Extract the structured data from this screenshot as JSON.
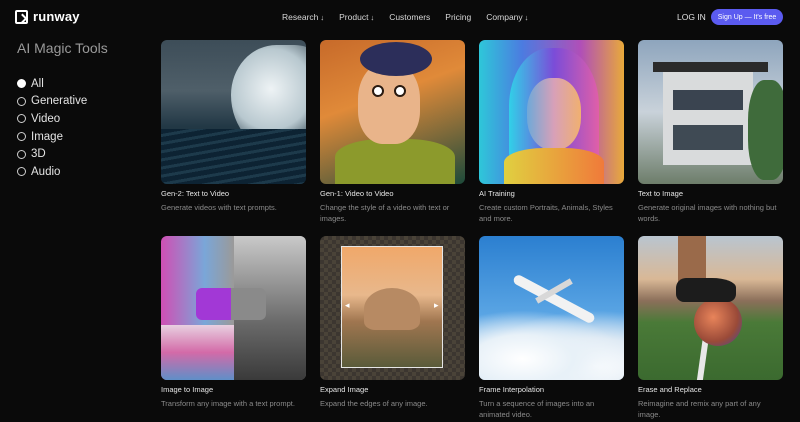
{
  "nav": {
    "logo_text": "runway",
    "links": [
      {
        "label": "Research",
        "arrow": "↓"
      },
      {
        "label": "Product",
        "arrow": "↓"
      },
      {
        "label": "Customers",
        "arrow": ""
      },
      {
        "label": "Pricing",
        "arrow": ""
      },
      {
        "label": "Company",
        "arrow": "↓"
      }
    ],
    "login": "LOG IN",
    "signup": "Sign Up — It's free"
  },
  "sidebar": {
    "title": "AI Magic Tools",
    "filters": [
      {
        "label": "All",
        "selected": true
      },
      {
        "label": "Generative",
        "selected": false
      },
      {
        "label": "Video",
        "selected": false
      },
      {
        "label": "Image",
        "selected": false
      },
      {
        "label": "3D",
        "selected": false
      },
      {
        "label": "Audio",
        "selected": false
      }
    ]
  },
  "cards": [
    {
      "title": "Gen-2: Text to Video",
      "desc": "Generate videos with text prompts."
    },
    {
      "title": "Gen-1: Video to Video",
      "desc": "Change the style of a video with text or images."
    },
    {
      "title": "AI Training",
      "desc": "Create custom Portraits, Animals, Styles and more."
    },
    {
      "title": "Text to Image",
      "desc": "Generate original images with nothing but words."
    },
    {
      "title": "Image to Image",
      "desc": "Transform any image with a text prompt."
    },
    {
      "title": "Expand Image",
      "desc": "Expand the edges of any image."
    },
    {
      "title": "Frame Interpolation",
      "desc": "Turn a sequence of images into an animated video."
    },
    {
      "title": "Erase and Replace",
      "desc": "Reimagine and remix any part of any image."
    }
  ],
  "colors": {
    "accent": "#5b5bf0",
    "background": "#0a0a0a"
  }
}
